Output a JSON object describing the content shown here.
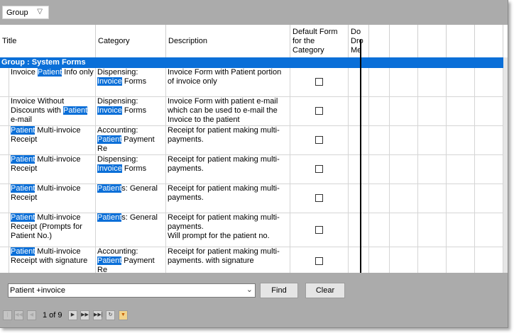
{
  "group_panel": {
    "label": "Group",
    "filter_icon": "funnel-icon"
  },
  "columns": [
    "Title",
    "Category",
    "Description",
    "Default Form for the Category",
    "Do Dro Me"
  ],
  "group_row": "Group : System Forms",
  "rows": [
    {
      "title": [
        {
          "t": "Invoice "
        },
        {
          "t": "Patient",
          "h": true
        },
        {
          "t": " Info only"
        }
      ],
      "category": [
        {
          "t": "Dispensing: "
        },
        {
          "t": "Invoice",
          "h": true
        },
        {
          "t": " Forms"
        }
      ],
      "description": "Invoice Form with  Patient portion of invoice only",
      "default": false
    },
    {
      "title": [
        {
          "t": "Invoice Without Discounts with "
        },
        {
          "t": "Patient",
          "h": true
        },
        {
          "t": " e-mail"
        }
      ],
      "category": [
        {
          "t": "Dispensing: "
        },
        {
          "t": "Invoice",
          "h": true
        },
        {
          "t": " Forms"
        }
      ],
      "description": "Invoice Form with patient e-mail which can be used to e-mail the Invoice to the patient",
      "default": false
    },
    {
      "title": [
        {
          "t": "Patient",
          "h": true
        },
        {
          "t": " Multi-invoice Receipt"
        }
      ],
      "category": [
        {
          "t": "Accounting: "
        },
        {
          "t": "Patient",
          "h": true
        },
        {
          "t": " Payment Re"
        }
      ],
      "description": "Receipt for patient making multi-payments.",
      "default": false
    },
    {
      "title": [
        {
          "t": "Patient",
          "h": true
        },
        {
          "t": " Multi-invoice Receipt"
        }
      ],
      "category": [
        {
          "t": "Dispensing: "
        },
        {
          "t": "Invoice",
          "h": true
        },
        {
          "t": " Forms"
        }
      ],
      "description": "Receipt for patient making multi-payments.",
      "default": false
    },
    {
      "title": [
        {
          "t": "Patient",
          "h": true
        },
        {
          "t": " Multi-invoice Receipt"
        }
      ],
      "category": [
        {
          "t": "Patient",
          "h": true
        },
        {
          "t": "s: General"
        }
      ],
      "description": "Receipt for patient making multi-payments.",
      "default": false
    },
    {
      "title": [
        {
          "t": "Patient",
          "h": true
        },
        {
          "t": " Multi-invoice Receipt (Prompts for Patient No.)"
        }
      ],
      "category": [
        {
          "t": "Patient",
          "h": true
        },
        {
          "t": "s: General"
        }
      ],
      "description": "Receipt for patient making multi-payments.\nWill prompt for the patient no.",
      "default": false
    },
    {
      "title": [
        {
          "t": "Patient",
          "h": true
        },
        {
          "t": " Multi-invoice Receipt with signature"
        }
      ],
      "category": [
        {
          "t": "Accounting: "
        },
        {
          "t": "Patient",
          "h": true
        },
        {
          "t": " Payment Re"
        }
      ],
      "description": "Receipt for patient making multi-payments. with signature",
      "default": false
    }
  ],
  "search": {
    "value": "Patient +invoice",
    "find_label": "Find",
    "clear_label": "Clear"
  },
  "pager": {
    "text": "1 of 9"
  }
}
